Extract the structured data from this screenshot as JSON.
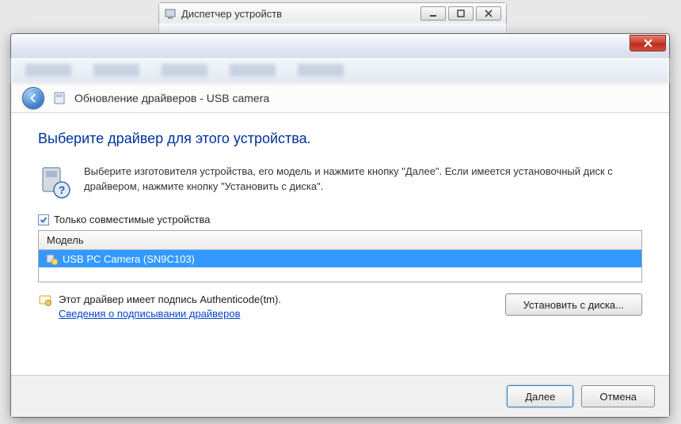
{
  "parent_window": {
    "title": "Диспетчер устройств"
  },
  "dialog": {
    "wizard_title": "Обновление драйверов - USB camera",
    "heading": "Выберите драйвер для этого устройства.",
    "instruction": "Выберите изготовителя устройства, его модель и нажмите кнопку \"Далее\". Если имеется установочный диск с драйвером, нажмите кнопку \"Установить с диска\".",
    "compatible_checkbox": "Только совместимые устройства",
    "model_header": "Модель",
    "model_item": "USB PC Camera (SN9C103)",
    "signature_text": "Этот драйвер имеет подпись Authenticode(tm).",
    "signature_link": "Сведения о подписывании драйверов",
    "install_disk_btn": "Установить с диска...",
    "next_btn": "Далее",
    "cancel_btn": "Отмена"
  }
}
